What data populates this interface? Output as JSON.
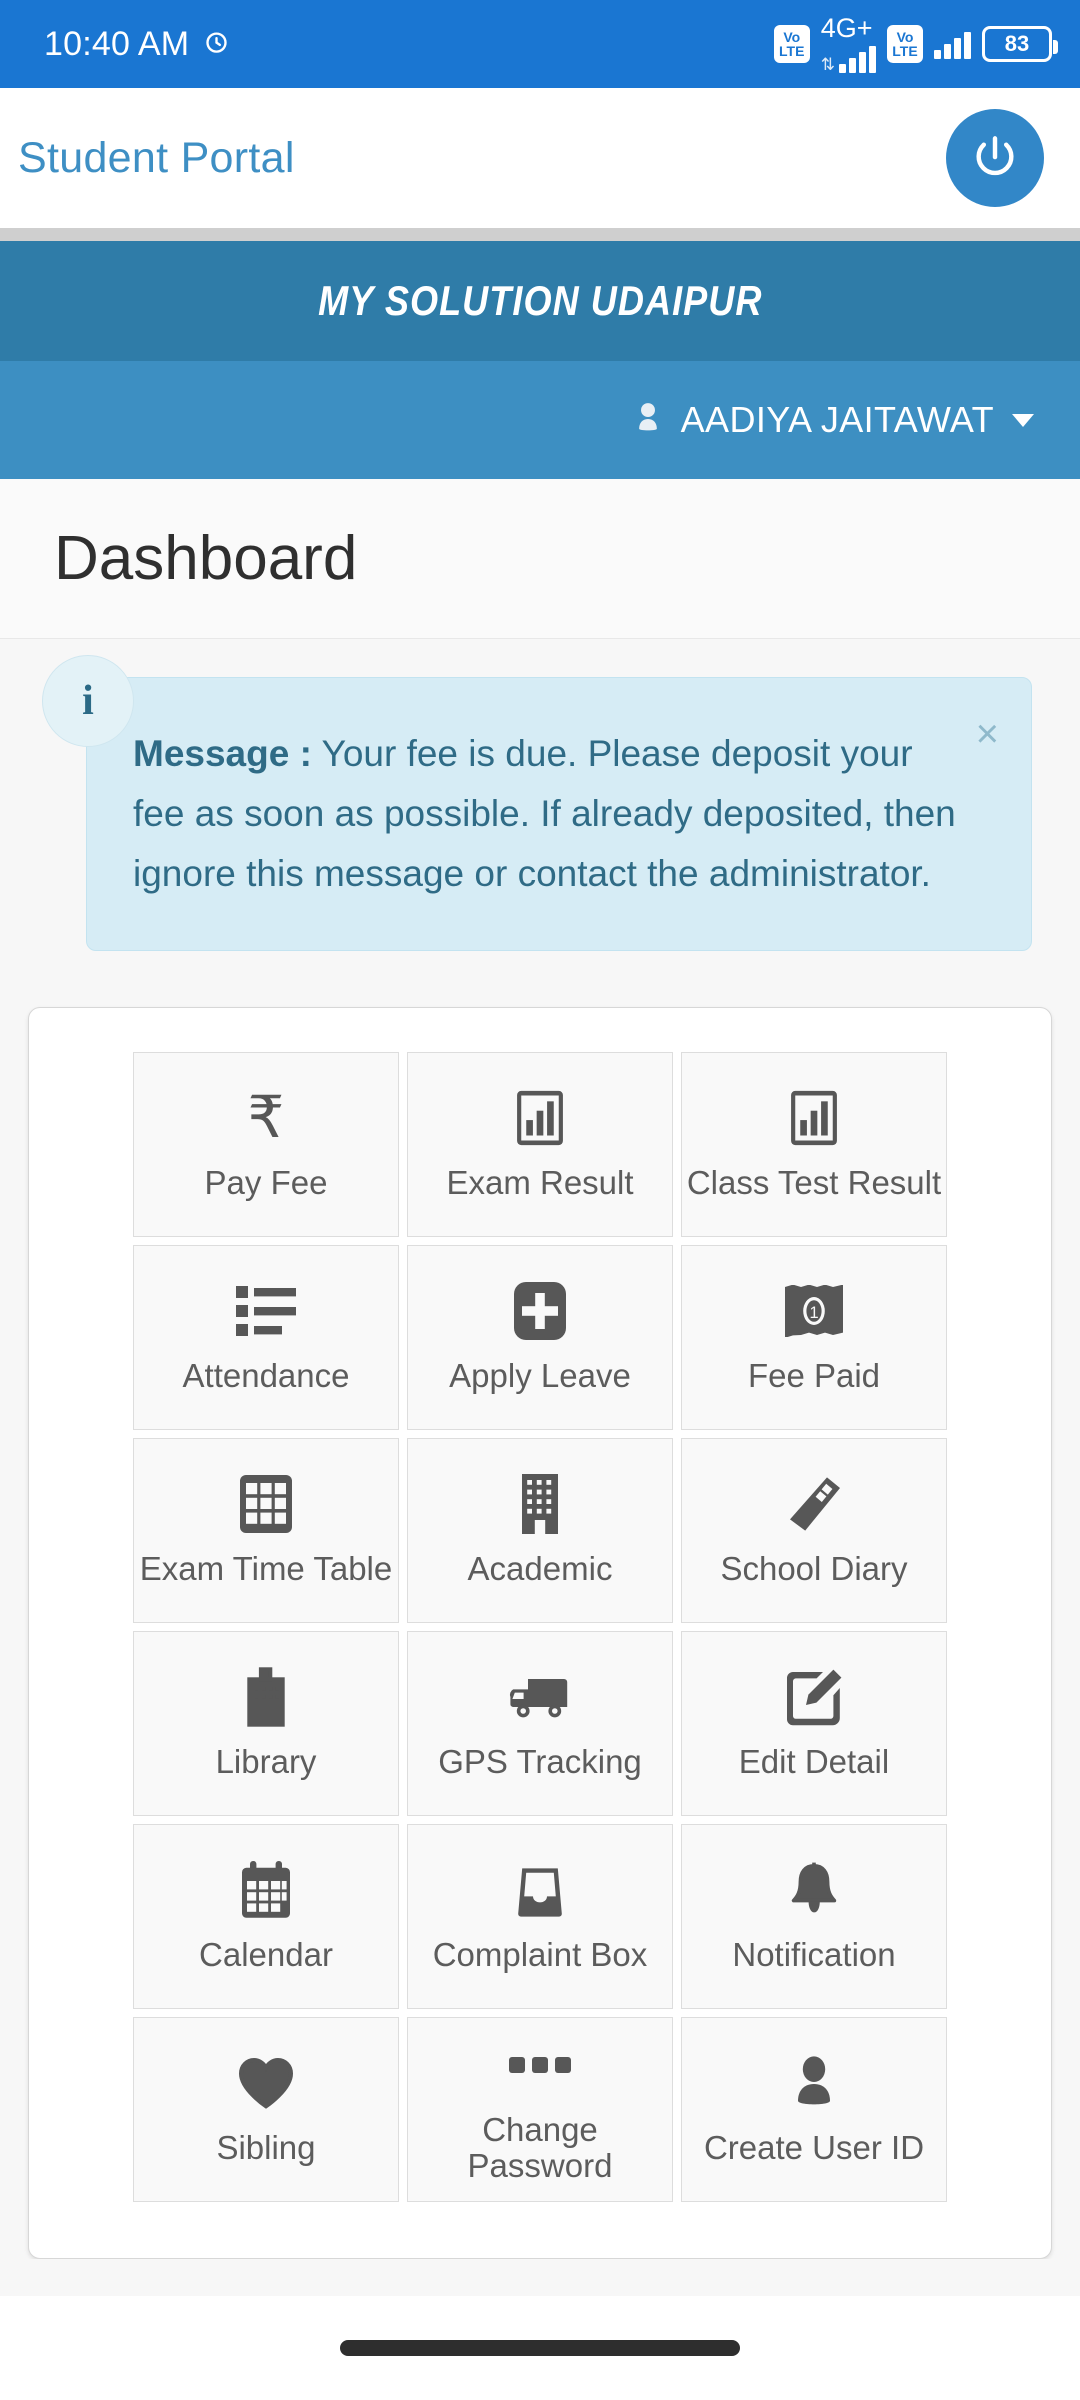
{
  "statusbar": {
    "time": "10:40 AM",
    "alarm_icon": "alarm-icon",
    "sim1_volte": "VoLTE",
    "network_type": "4G+",
    "sim2_volte": "VoLTE",
    "battery_percent": "83",
    "data_arrows": "⇅"
  },
  "appbar": {
    "title": "Student Portal",
    "power_icon": "power-icon"
  },
  "banner": {
    "school_name": "MY SOLUTION UDAIPUR",
    "user_name": "AADIYA JAITAWAT",
    "user_icon": "user-icon",
    "caret_icon": "chevron-down-icon"
  },
  "page": {
    "title": "Dashboard"
  },
  "alert": {
    "info_icon": "i",
    "label": "Message :",
    "body": " Your fee is due. Please deposit your fee as soon as possible. If already deposited, then ignore this message or contact the administrator.",
    "close_label": "×"
  },
  "colors": {
    "status_bar": "#1a76d2",
    "app_title": "#3e8fc4",
    "school_band": "#2f7ca8",
    "user_band": "#3d8fc2",
    "power_button": "#3287c8",
    "alert_bg": "#d6ecf5",
    "alert_text": "#2f6b86",
    "tile_bg": "#f9f9f9",
    "tile_icon": "#575757"
  },
  "grid": {
    "tiles": [
      {
        "label": "Pay Fee",
        "icon": "rupee-icon"
      },
      {
        "label": "Exam Result",
        "icon": "bar-chart-icon"
      },
      {
        "label": "Class Test Result",
        "icon": "bar-chart-icon"
      },
      {
        "label": "Attendance",
        "icon": "list-icon"
      },
      {
        "label": "Apply Leave",
        "icon": "plus-square-icon"
      },
      {
        "label": "Fee Paid",
        "icon": "banknote-icon"
      },
      {
        "label": "Exam Time Table",
        "icon": "table-grid-icon"
      },
      {
        "label": "Academic",
        "icon": "building-icon"
      },
      {
        "label": "School Diary",
        "icon": "book-icon"
      },
      {
        "label": "Library",
        "icon": "library-building-icon"
      },
      {
        "label": "GPS Tracking",
        "icon": "truck-icon"
      },
      {
        "label": "Edit Detail",
        "icon": "pencil-square-icon"
      },
      {
        "label": "Calendar",
        "icon": "calendar-icon"
      },
      {
        "label": "Complaint Box",
        "icon": "inbox-icon"
      },
      {
        "label": "Notification",
        "icon": "bell-icon"
      },
      {
        "label": "Sibling",
        "icon": "heart-icon"
      },
      {
        "label": "Change Password",
        "icon": "ellipsis-icon"
      },
      {
        "label": "Create User ID",
        "icon": "person-icon"
      }
    ]
  },
  "navbar": {
    "gesture_pill": "home-gesture-pill"
  }
}
